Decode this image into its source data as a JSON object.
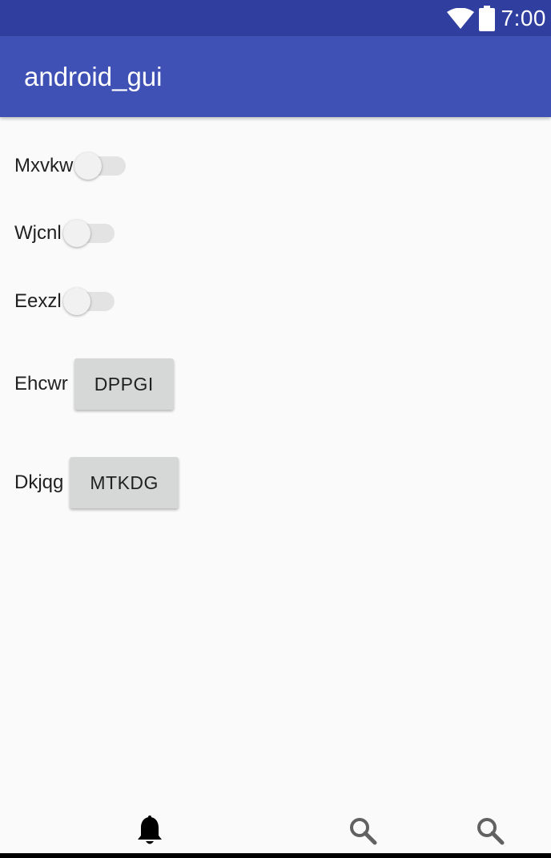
{
  "status_bar": {
    "time": "7:00",
    "icons": [
      "wifi-icon",
      "battery-icon"
    ]
  },
  "app_bar": {
    "title": "android_gui"
  },
  "rows": [
    {
      "label": "Mxvkw",
      "control": "switch",
      "checked": false
    },
    {
      "label": "Wjcnl",
      "control": "switch",
      "checked": false
    },
    {
      "label": "Eexzl",
      "control": "switch",
      "checked": false
    },
    {
      "label": "Ehcwr",
      "control": "button",
      "button_label": "DPPGI"
    },
    {
      "label": "Dkjqg",
      "control": "button",
      "button_label": "MTKDG"
    }
  ],
  "bottom_nav": {
    "items": [
      {
        "icon": "bell-icon",
        "active": true
      },
      {
        "icon": "search-icon",
        "active": false
      },
      {
        "icon": "search-icon",
        "active": false
      }
    ]
  },
  "colors": {
    "status_bar": "#303f9f",
    "app_bar": "#3f51b5",
    "background": "#fafafa",
    "button": "#d6d7d7",
    "switch_track": "#e3e3e3",
    "switch_thumb": "#f1f1f1"
  }
}
